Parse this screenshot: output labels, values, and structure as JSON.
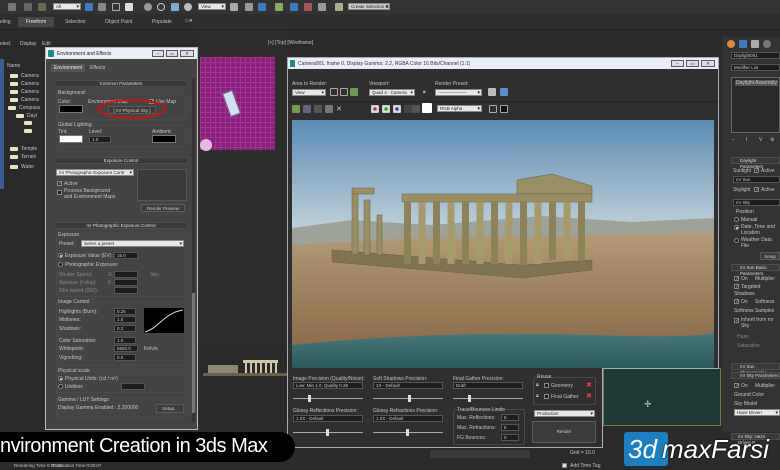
{
  "toolbar": {
    "selection_filter": "All",
    "ref_coord": "View",
    "named_selection": "Create Selection Set"
  },
  "ribbon": {
    "tabs": [
      "eling",
      "Freeform",
      "Selection",
      "Object Paint",
      "Populate"
    ],
    "active": "Freeform"
  },
  "scene_explorer": {
    "menus": [
      "elect",
      "Display",
      "Edit"
    ],
    "column_header": "Name",
    "items": [
      "Camera",
      "Camera",
      "Camera",
      "Camera",
      "Compass",
      "Dayl",
      "",
      "",
      "Temple",
      "Terrain",
      "Water"
    ]
  },
  "viewport_top": {
    "label": "[+] [Top] [Wireframe]"
  },
  "env_dialog": {
    "title": "Environment and Effects",
    "tabs": [
      "Environment",
      "Effects"
    ],
    "common": {
      "header": "Common Parameters",
      "background": "Background:",
      "color": "Color:",
      "env_map": "Environment Map:",
      "use_map": "Use Map",
      "map_button": "[ mr Physical Sky ]",
      "global_lighting": "Global Lighting:",
      "tint": "Tint:",
      "level": "Level:",
      "level_value": "1.0",
      "ambient": "Ambient:",
      "background_color": "#000000",
      "tint_color": "#ffffff",
      "ambient_color": "#000000",
      "highlight_color": "#d01010"
    },
    "exposure": {
      "header": "Exposure Control",
      "type": "mr Photographic Exposure Contr",
      "active": "Active",
      "process_bg": "Process Background",
      "process_bg2": "and Environment Maps",
      "render_preview": "Render Preview"
    },
    "mr_exposure": {
      "header": "mr Photographic Exposure Control",
      "exposure": "Exposure",
      "preset_label": "Preset:",
      "preset": "Select a preset",
      "ev_label": "Exposure Value (EV):",
      "ev": "15.0",
      "photographic": "Photographic Exposure:",
      "shutter": "Shutter Speed:",
      "shutter_prefix": "1/",
      "sec": "Sec.",
      "aperture": "Aperture (f-stop):",
      "aperture_prefix": "f/",
      "film": "Film speed (ISO):",
      "image_control": "Image Control",
      "highlights": "Highlights (Burn):",
      "highlights_v": "0.25",
      "midtones": "Midtones:",
      "midtones_v": "1.0",
      "shadows": "Shadows:",
      "shadows_v": "0.2",
      "saturation": "Color Saturation:",
      "saturation_v": "1.0",
      "whitepoint": "Whitepoint:",
      "whitepoint_v": "6500.0",
      "kelvin": "Kelvin",
      "vignetting": "Vignetting:",
      "vignetting_v": "0.0",
      "physical_scale": "Physical scale",
      "physical_units": "Physical Units: (cd / m²)",
      "unitless": "Unitless",
      "gamma": "Gamma / LUT Settings",
      "gamma_text": "Display Gamma Enabled : 2.200000",
      "setup": "Setup..."
    }
  },
  "render_window": {
    "title": "Camera001, frame 0, Display Gamma: 2.2, RGBA Color 16 Bits/Channel (1:1)",
    "area_label": "Area to Render:",
    "area": "View",
    "viewport_label": "Viewport:",
    "viewport": "Quad 4 - Camera",
    "preset_label": "Render Preset:",
    "preset": "-------------------",
    "channel": "RGB Alpha",
    "image_precision": "Image Precision (Quality/Noise):",
    "image_precision_v": "Low: Min 1.0, Quality 0.25",
    "soft_shadows": "Soft Shadows Precision:",
    "soft_shadows_v": "1X - Default",
    "final_gather": "Final Gather Precision:",
    "final_gather_v": "Draft",
    "reuse": "Reuse",
    "geometry": "Geometry",
    "final_gather_reuse": "Final Gather",
    "glossy_refl": "Glossy Reflections Precision:",
    "glossy_refl_v": "1.0X - Default",
    "glossy_refr": "Glossy Refractions Precision:",
    "glossy_refr_v": "1.0X - Default",
    "trace": "Trace/Bounces Limits",
    "max_refl": "Max. Reflections:",
    "max_refl_v": "6",
    "max_refr": "Max. Refractions:",
    "max_refr_v": "6",
    "fg_bounces": "FG Bounces:",
    "fg_bounces_v": "0",
    "mode": "Production",
    "render": "Render"
  },
  "command_panel": {
    "object_name": "Daylight001",
    "modifier_list": "Modifier List",
    "stack_item": "Daylight Assembly",
    "daylight_params": "Daylight Parameters",
    "sunlight": "Sunlight",
    "active": "Active",
    "sun": "mr Sun",
    "skylight": "Skylight",
    "sky": "mr Sky",
    "position": "Position",
    "manual": "Manual",
    "date_time": "Date, Time and Location",
    "weather": "Weather Data File",
    "setup": "Setup",
    "sun_basic": "mr Sun Basic Parameters",
    "on": "On",
    "multiplier": "Multiplier",
    "targeted": "Targeted",
    "shadows": "Shadows",
    "softness": "Softness",
    "softness_samples": "Softness Samples",
    "inherit": "Inherit from mr Sky",
    "haze": "Haze",
    "saturation": "Saturation",
    "sun_photographic": "mr Sun Photographic",
    "sky_params": "mr Sky Parameters",
    "ground_color": "Ground Color",
    "sky_model": "Sky Model",
    "haze_driven": "Haze Driven",
    "sky_haze": "mr Sky: Haze Driven P"
  },
  "status": {
    "grid": "Grid = 10.0",
    "add_time_tag": "Add Time Tag",
    "rendering_time": "Rendering Time 0:00:20",
    "translation_time": "Translation Time 0:00:07"
  },
  "banner": {
    "title": "nvironment Creation in 3ds Max"
  },
  "watermark": {
    "brand_a": "3d",
    "brand_b": "maxFarsi",
    "brand_color": "#1b7fc4"
  }
}
